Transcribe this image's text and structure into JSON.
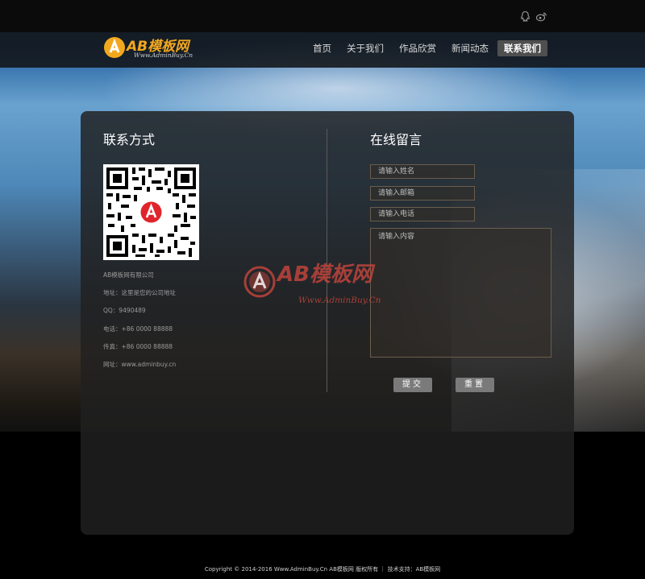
{
  "header": {
    "social_icons": [
      "qq-icon",
      "weibo-icon"
    ]
  },
  "logo": {
    "title": "AB模板网",
    "subtitle": "Www.AdminBuy.Cn"
  },
  "nav": {
    "items": [
      {
        "label": "首页"
      },
      {
        "label": "关于我们"
      },
      {
        "label": "作品欣赏"
      },
      {
        "label": "新闻动态"
      },
      {
        "label": "联系我们",
        "active": true
      }
    ]
  },
  "contact": {
    "title": "联系方式",
    "company": "AB模板网有限公司",
    "address": "地址：这里是您的公司地址",
    "qq": "QQ：9490489",
    "phone": "电话：+86 0000 88888",
    "fax": "传真：+86 0000 88888",
    "website": "网址：www.adminbuy.cn"
  },
  "message": {
    "title": "在线留言",
    "name_placeholder": "请输入姓名",
    "email_placeholder": "请输入邮箱",
    "phone_placeholder": "请输入电话",
    "content_placeholder": "请输入内容",
    "submit_label": "提交",
    "reset_label": "重置"
  },
  "watermark": {
    "title": "AB模板网",
    "subtitle": "Www.AdminBuy.Cn"
  },
  "footer": {
    "text": "Copyright © 2014-2016 Www.AdminBuy.Cn AB模板网 版权所有 ｜ 技术支持：AB模板网"
  },
  "colors": {
    "accent": "#f2a81e",
    "panel": "#202020",
    "nav_active": "#4f4f4f",
    "button": "#7a7a7a"
  }
}
